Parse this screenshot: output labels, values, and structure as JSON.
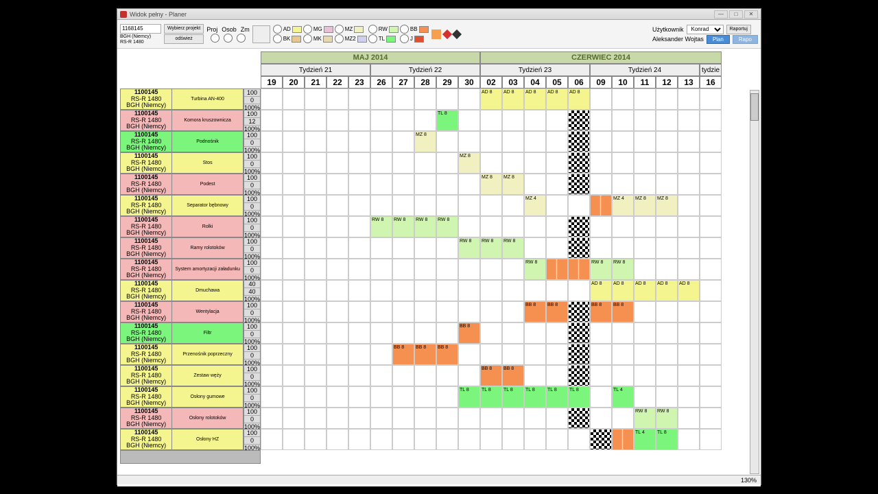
{
  "window": {
    "title": "Widok pełny - Planer"
  },
  "toolbar": {
    "project_id": "1168145",
    "project_name": "BGH (Niemcy)",
    "project_sub": "RS-R 1480",
    "btn_select": "Wybierz projekt",
    "btn_refresh": "odśwież",
    "col_proj": "Proj",
    "col_osob": "Osob",
    "col_zm": "Zm",
    "user_lbl": "Użytkownik",
    "user_name": "Aleksander Wojtas",
    "user_sel": "Konrad",
    "btn_plan": "Plan",
    "btn_rapo": "Rapo",
    "btn_rap": "Raportuj"
  },
  "legend_codes": [
    "AD",
    "BK",
    "MG",
    "MK",
    "MZ",
    "MZ2",
    "RW",
    "TL",
    "BB",
    "J"
  ],
  "months": [
    {
      "name": "MAJ 2014",
      "span": 5
    },
    {
      "name": "CZERWIEC 2014",
      "span": 11
    }
  ],
  "weeks": [
    {
      "name": "Tydzień 21",
      "span": 5
    },
    {
      "name": "Tydzień 22",
      "span": 5
    },
    {
      "name": "Tydzień 23",
      "span": 5
    },
    {
      "name": "Tydzień 24",
      "span": 5
    },
    {
      "name": "tydzie",
      "span": 1
    }
  ],
  "days": [
    "19",
    "20",
    "21",
    "22",
    "23",
    "26",
    "27",
    "28",
    "29",
    "30",
    "02",
    "03",
    "04",
    "05",
    "06",
    "09",
    "10",
    "11",
    "12",
    "13",
    "16"
  ],
  "row_meta": {
    "id": "1100145",
    "sub": "RS-R 1480",
    "client": "BGH (Niemcy)"
  },
  "stat_default": [
    "100",
    "0",
    "100%"
  ],
  "rows": [
    {
      "name": "Turbina AN-400",
      "color": "bg-yellow",
      "cells": {
        "10": "AD 8",
        "11": "AD 8",
        "12": "AD 8",
        "13": "AD 8",
        "14": "AD 8"
      },
      "cls": "c-ad"
    },
    {
      "name": "Komora kruszownicza",
      "color": "bg-pink",
      "stats": [
        "100",
        "12",
        "100%"
      ],
      "cells": {
        "8": "TL 8",
        "14": "flag"
      },
      "cls": "c-tl"
    },
    {
      "name": "Podnośnik",
      "color": "bg-green",
      "cells": {
        "7": "MZ 8",
        "14": "flag"
      },
      "cls": "c-mz"
    },
    {
      "name": "Stos",
      "color": "bg-yellow",
      "cells": {
        "9": "MZ 8",
        "14": "flag"
      },
      "cls": "c-mz"
    },
    {
      "name": "Podest",
      "color": "bg-pink",
      "cells": {
        "10": "MZ 8",
        "11": "MZ 8",
        "14": "flag"
      },
      "cls": "c-mz"
    },
    {
      "name": "Separator bębnowy",
      "color": "bg-yellow",
      "cells": {
        "12": "MZ 4",
        "15": "rip",
        "16": "MZ 4",
        "17": "MZ 8",
        "18": "MZ 8"
      },
      "cls": "c-mz"
    },
    {
      "name": "Rolki",
      "color": "bg-pink",
      "cells": {
        "5": "RW 8",
        "6": "RW 8",
        "7": "RW 8",
        "8": "RW 8",
        "14": "flag"
      },
      "cls": "c-rw"
    },
    {
      "name": "Ramy rolotoków",
      "color": "bg-pink",
      "cells": {
        "9": "RW 8",
        "10": "RW 8",
        "11": "RW 8",
        "14": "flag"
      },
      "cls": "c-rw"
    },
    {
      "name": "System amortyzacji załadunku",
      "color": "bg-pink",
      "cells": {
        "12": "RW 8",
        "13": "rip",
        "14": "rip",
        "15": "RW 8",
        "16": "RW 8"
      },
      "cls": "c-rw"
    },
    {
      "name": "Dmuchawa",
      "color": "bg-yellow",
      "stats": [
        "40",
        "40",
        "100%"
      ],
      "cells": {
        "15": "AD 8",
        "16": "AD 8",
        "17": "AD 8",
        "18": "AD 8",
        "19": "AD 8"
      },
      "cls": "c-ad"
    },
    {
      "name": "Wentylacja",
      "color": "bg-pink",
      "cells": {
        "12": "BB 8",
        "13": "BB 8",
        "14": "flag",
        "15": "BB 8",
        "16": "BB 8"
      },
      "cls": "c-bb"
    },
    {
      "name": "Filtr",
      "color": "bg-green",
      "cells": {
        "9": "BB 8",
        "14": "flag"
      },
      "cls": "c-bb"
    },
    {
      "name": "Przenośnik poprzeczny",
      "color": "bg-yellow",
      "cells": {
        "6": "BB 8",
        "7": "BB 8",
        "8": "BB 8",
        "14": "flag"
      },
      "cls": "c-bb"
    },
    {
      "name": "Zestaw węży",
      "color": "bg-yellow",
      "cells": {
        "10": "BB 8",
        "11": "BB 8",
        "14": "flag"
      },
      "cls": "c-bb"
    },
    {
      "name": "Osłony gumowe",
      "color": "bg-yellow",
      "cells": {
        "9": "TL 8",
        "10": "TL 8",
        "11": "TL 8",
        "12": "TL 8",
        "13": "TL 8",
        "14": "TL 8",
        "16": "TL 4"
      },
      "cls": "c-tl"
    },
    {
      "name": "Osłony rolotoków",
      "color": "bg-pink",
      "cells": {
        "14": "flag",
        "17": "RW 8",
        "18": "RW 8"
      },
      "cls": "c-rw"
    },
    {
      "name": "Osłony HZ",
      "color": "bg-yellow",
      "cells": {
        "15": "flag",
        "16": "rip",
        "17": "TL 4",
        "18": "TL 8"
      },
      "cls": "c-tl"
    }
  ],
  "status": {
    "zoom": "130%"
  }
}
